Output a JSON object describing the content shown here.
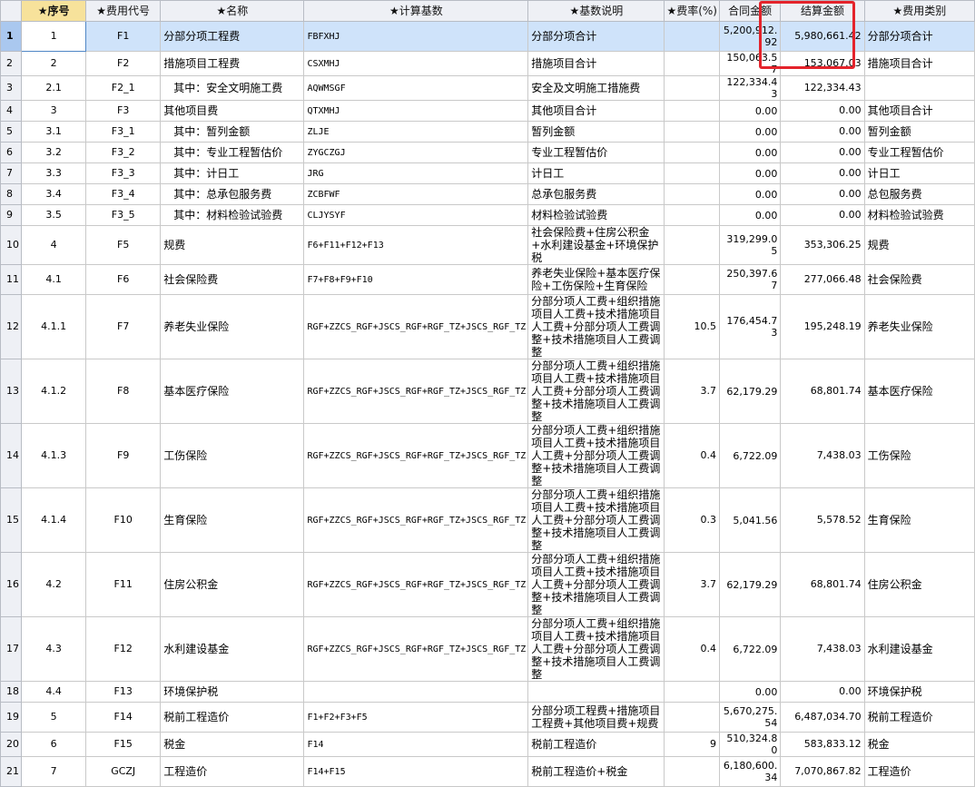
{
  "columns": {
    "rownum": "",
    "seq": "★序号",
    "code": "★费用代号",
    "name": "★名称",
    "base": "★计算基数",
    "desc": "★基数说明",
    "rate": "★费率(%)",
    "contract": "合同金额",
    "settle": "结算金额",
    "category": "★费用类别"
  },
  "rows": [
    {
      "n": "1",
      "seq": "1",
      "code": "F1",
      "name": "分部分项工程费",
      "base": "FBFXHJ",
      "desc": "分部分项合计",
      "rate": "",
      "contract": "5,200,912.92",
      "settle": "5,980,661.42",
      "category": "分部分项合计"
    },
    {
      "n": "2",
      "seq": "2",
      "code": "F2",
      "name": "措施项目工程费",
      "base": "CSXMHJ",
      "desc": "措施项目合计",
      "rate": "",
      "contract": "150,063.57",
      "settle": "153,067.03",
      "category": "措施项目合计"
    },
    {
      "n": "3",
      "seq": "2.1",
      "code": "F2_1",
      "name": "其中：安全文明施工费",
      "base": "AQWMSGF",
      "desc": "安全及文明施工措施费",
      "rate": "",
      "contract": "122,334.43",
      "settle": "122,334.43",
      "category": ""
    },
    {
      "n": "4",
      "seq": "3",
      "code": "F3",
      "name": "其他项目费",
      "base": "QTXMHJ",
      "desc": "其他项目合计",
      "rate": "",
      "contract": "0.00",
      "settle": "0.00",
      "category": "其他项目合计"
    },
    {
      "n": "5",
      "seq": "3.1",
      "code": "F3_1",
      "name": "其中：暂列金额",
      "base": "ZLJE",
      "desc": "暂列金额",
      "rate": "",
      "contract": "0.00",
      "settle": "0.00",
      "category": "暂列金额"
    },
    {
      "n": "6",
      "seq": "3.2",
      "code": "F3_2",
      "name": "其中：专业工程暂估价",
      "base": "ZYGCZGJ",
      "desc": "专业工程暂估价",
      "rate": "",
      "contract": "0.00",
      "settle": "0.00",
      "category": "专业工程暂估价"
    },
    {
      "n": "7",
      "seq": "3.3",
      "code": "F3_3",
      "name": "其中：计日工",
      "base": "JRG",
      "desc": "计日工",
      "rate": "",
      "contract": "0.00",
      "settle": "0.00",
      "category": "计日工"
    },
    {
      "n": "8",
      "seq": "3.4",
      "code": "F3_4",
      "name": "其中：总承包服务费",
      "base": "ZCBFWF",
      "desc": "总承包服务费",
      "rate": "",
      "contract": "0.00",
      "settle": "0.00",
      "category": "总包服务费"
    },
    {
      "n": "9",
      "seq": "3.5",
      "code": "F3_5",
      "name": "其中：材料检验试验费",
      "base": "CLJYSYF",
      "desc": "材料检验试验费",
      "rate": "",
      "contract": "0.00",
      "settle": "0.00",
      "category": "材料检验试验费"
    },
    {
      "n": "10",
      "seq": "4",
      "code": "F5",
      "name": "规费",
      "base": "F6+F11+F12+F13",
      "desc": "社会保险费+住房公积金+水利建设基金+环境保护税",
      "rate": "",
      "contract": "319,299.05",
      "settle": "353,306.25",
      "category": "规费"
    },
    {
      "n": "11",
      "seq": "4.1",
      "code": "F6",
      "name": "社会保险费",
      "base": "F7+F8+F9+F10",
      "desc": "养老失业保险+基本医疗保险+工伤保险+生育保险",
      "rate": "",
      "contract": "250,397.67",
      "settle": "277,066.48",
      "category": "社会保险费"
    },
    {
      "n": "12",
      "seq": "4.1.1",
      "code": "F7",
      "name": "养老失业保险",
      "base": "RGF+ZZCS_RGF+JSCS_RGF+RGF_TZ+JSCS_RGF_TZ",
      "desc": "分部分项人工费+组织措施项目人工费+技术措施项目人工费+分部分项人工费调整+技术措施项目人工费调整",
      "rate": "10.5",
      "contract": "176,454.73",
      "settle": "195,248.19",
      "category": "养老失业保险"
    },
    {
      "n": "13",
      "seq": "4.1.2",
      "code": "F8",
      "name": "基本医疗保险",
      "base": "RGF+ZZCS_RGF+JSCS_RGF+RGF_TZ+JSCS_RGF_TZ",
      "desc": "分部分项人工费+组织措施项目人工费+技术措施项目人工费+分部分项人工费调整+技术措施项目人工费调整",
      "rate": "3.7",
      "contract": "62,179.29",
      "settle": "68,801.74",
      "category": "基本医疗保险"
    },
    {
      "n": "14",
      "seq": "4.1.3",
      "code": "F9",
      "name": "工伤保险",
      "base": "RGF+ZZCS_RGF+JSCS_RGF+RGF_TZ+JSCS_RGF_TZ",
      "desc": "分部分项人工费+组织措施项目人工费+技术措施项目人工费+分部分项人工费调整+技术措施项目人工费调整",
      "rate": "0.4",
      "contract": "6,722.09",
      "settle": "7,438.03",
      "category": "工伤保险"
    },
    {
      "n": "15",
      "seq": "4.1.4",
      "code": "F10",
      "name": "生育保险",
      "base": "RGF+ZZCS_RGF+JSCS_RGF+RGF_TZ+JSCS_RGF_TZ",
      "desc": "分部分项人工费+组织措施项目人工费+技术措施项目人工费+分部分项人工费调整+技术措施项目人工费调整",
      "rate": "0.3",
      "contract": "5,041.56",
      "settle": "5,578.52",
      "category": "生育保险"
    },
    {
      "n": "16",
      "seq": "4.2",
      "code": "F11",
      "name": "住房公积金",
      "base": "RGF+ZZCS_RGF+JSCS_RGF+RGF_TZ+JSCS_RGF_TZ",
      "desc": "分部分项人工费+组织措施项目人工费+技术措施项目人工费+分部分项人工费调整+技术措施项目人工费调整",
      "rate": "3.7",
      "contract": "62,179.29",
      "settle": "68,801.74",
      "category": "住房公积金"
    },
    {
      "n": "17",
      "seq": "4.3",
      "code": "F12",
      "name": "水利建设基金",
      "base": "RGF+ZZCS_RGF+JSCS_RGF+RGF_TZ+JSCS_RGF_TZ",
      "desc": "分部分项人工费+组织措施项目人工费+技术措施项目人工费+分部分项人工费调整+技术措施项目人工费调整",
      "rate": "0.4",
      "contract": "6,722.09",
      "settle": "7,438.03",
      "category": "水利建设基金"
    },
    {
      "n": "18",
      "seq": "4.4",
      "code": "F13",
      "name": "环境保护税",
      "base": "",
      "desc": "",
      "rate": "",
      "contract": "0.00",
      "settle": "0.00",
      "category": "环境保护税"
    },
    {
      "n": "19",
      "seq": "5",
      "code": "F14",
      "name": "税前工程造价",
      "base": "F1+F2+F3+F5",
      "desc": "分部分项工程费+措施项目工程费+其他项目费+规费",
      "rate": "",
      "contract": "5,670,275.54",
      "settle": "6,487,034.70",
      "category": "税前工程造价"
    },
    {
      "n": "20",
      "seq": "6",
      "code": "F15",
      "name": "税金",
      "base": "F14",
      "desc": "税前工程造价",
      "rate": "9",
      "contract": "510,324.80",
      "settle": "583,833.12",
      "category": "税金"
    },
    {
      "n": "21",
      "seq": "7",
      "code": "GCZJ",
      "name": "工程造价",
      "base": "F14+F15",
      "desc": "税前工程造价+税金",
      "rate": "",
      "contract": "6,180,600.34",
      "settle": "7,070,867.82",
      "category": "工程造价"
    }
  ],
  "colors": {
    "selected_row": "#cfe3fa",
    "header_highlight": "#f7e29b",
    "annotation_box": "#e4232b"
  }
}
